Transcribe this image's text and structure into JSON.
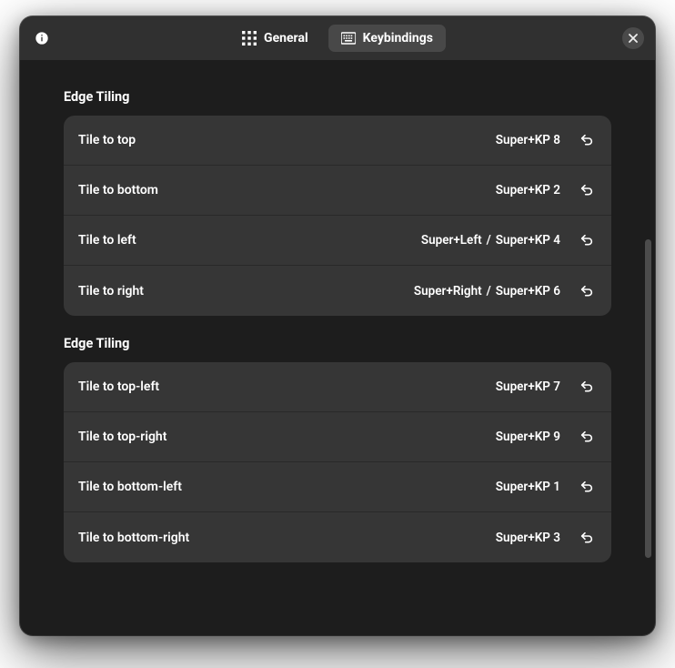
{
  "header": {
    "tabs": {
      "general": "General",
      "keybindings": "Keybindings"
    }
  },
  "sections": [
    {
      "title": "Edge Tiling",
      "rows": [
        {
          "label": "Tile to top",
          "shortcut": "Super+KP 8"
        },
        {
          "label": "Tile to bottom",
          "shortcut": "Super+KP 2"
        },
        {
          "label": "Tile to left",
          "shortcut": "Super+Left",
          "shortcut2": "Super+KP 4"
        },
        {
          "label": "Tile to right",
          "shortcut": "Super+Right",
          "shortcut2": "Super+KP 6"
        }
      ]
    },
    {
      "title": "Edge Tiling",
      "rows": [
        {
          "label": "Tile to top-left",
          "shortcut": "Super+KP 7"
        },
        {
          "label": "Tile to top-right",
          "shortcut": "Super+KP 9"
        },
        {
          "label": "Tile to bottom-left",
          "shortcut": "Super+KP 1"
        },
        {
          "label": "Tile to bottom-right",
          "shortcut": "Super+KP 3"
        }
      ]
    }
  ]
}
